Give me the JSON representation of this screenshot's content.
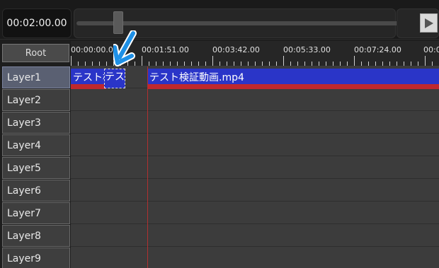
{
  "transport": {
    "current_time": "00:02:00.00",
    "play_icon": "play-icon"
  },
  "timeline": {
    "root_label": "Root",
    "ruler_labels": [
      "00:00:00.0",
      "00:01:51.00",
      "00:03:42.00",
      "00:05:33.00",
      "00:07:24.00",
      "00:0"
    ]
  },
  "layers": [
    "Layer1",
    "Layer2",
    "Layer3",
    "Layer4",
    "Layer5",
    "Layer6",
    "Layer7",
    "Layer8",
    "Layer9"
  ],
  "selected_layer": "Layer1",
  "clips": {
    "clip_a_label": "テスト検",
    "clip_drag_label": "テスト",
    "clip_main_label": "テスト検証動画.mp4"
  },
  "colors": {
    "video_track": "#2a35c8",
    "audio_track": "#c0282d",
    "pointer_arrow": "#1e90e6"
  }
}
